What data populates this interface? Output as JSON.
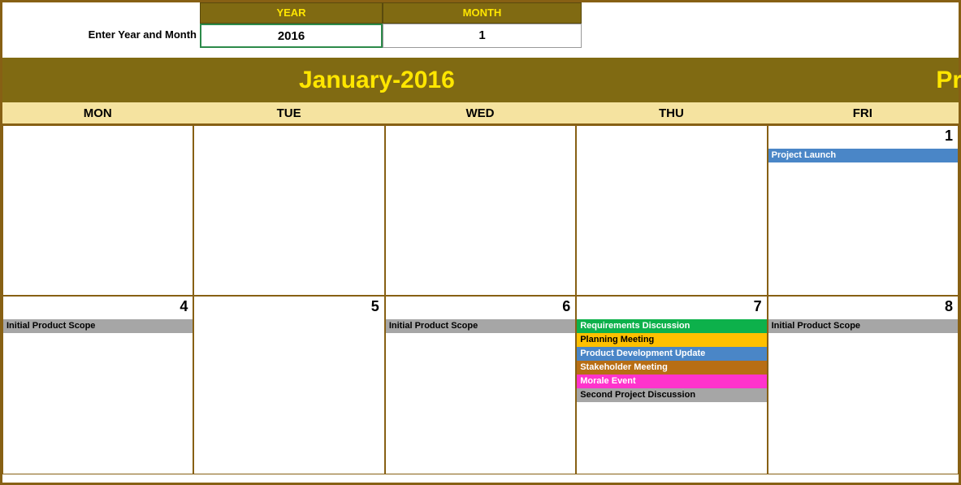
{
  "input": {
    "label": "Enter Year and Month",
    "yearHeader": "YEAR",
    "monthHeader": "MONTH",
    "yearValue": "2016",
    "monthValue": "1"
  },
  "title": {
    "month": "January-2016",
    "rightPartial": "Pr"
  },
  "dayHeaders": [
    "MON",
    "TUE",
    "WED",
    "THU",
    "FRI"
  ],
  "weeks": [
    {
      "days": [
        {
          "num": "",
          "events": []
        },
        {
          "num": "",
          "events": []
        },
        {
          "num": "",
          "events": []
        },
        {
          "num": "",
          "events": []
        },
        {
          "num": "1",
          "events": [
            {
              "text": "Project Launch",
              "cls": "ev-blue"
            }
          ]
        }
      ]
    },
    {
      "days": [
        {
          "num": "4",
          "events": [
            {
              "text": "Initial Product Scope",
              "cls": "ev-gray"
            }
          ]
        },
        {
          "num": "5",
          "events": []
        },
        {
          "num": "6",
          "events": [
            {
              "text": "Initial Product Scope",
              "cls": "ev-gray"
            }
          ]
        },
        {
          "num": "7",
          "events": [
            {
              "text": "Requirements Discussion",
              "cls": "ev-green"
            },
            {
              "text": "Planning Meeting",
              "cls": "ev-yellow"
            },
            {
              "text": "Product Development Update",
              "cls": "ev-blue"
            },
            {
              "text": "Stakeholder Meeting",
              "cls": "ev-brown"
            },
            {
              "text": "Morale Event",
              "cls": "ev-pink"
            },
            {
              "text": "Second Project Discussion",
              "cls": "ev-gray"
            }
          ]
        },
        {
          "num": "8",
          "events": [
            {
              "text": "Initial Product Scope",
              "cls": "ev-gray"
            }
          ]
        }
      ]
    }
  ]
}
